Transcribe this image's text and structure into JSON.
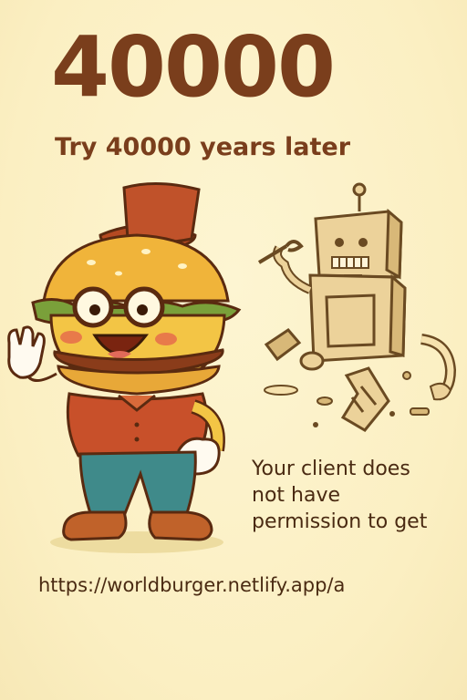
{
  "error": {
    "code": "40000",
    "subtitle": "Try 40000 years later",
    "message_lines": [
      "Your client does",
      "not have",
      "permission to get"
    ],
    "url": "https://worldburger.netlify.app/a"
  },
  "illustrations": {
    "mascot": "burger-mascot-icon",
    "robot": "broken-robot-icon"
  },
  "colors": {
    "background": "#fbf1c7",
    "heading": "#7a3e1c",
    "text": "#4a2a12",
    "bun": "#f0b43a",
    "hat": "#c0522a",
    "shirt": "#c8502a",
    "jeans": "#3f8a8a",
    "robot": "#ecd29a"
  }
}
